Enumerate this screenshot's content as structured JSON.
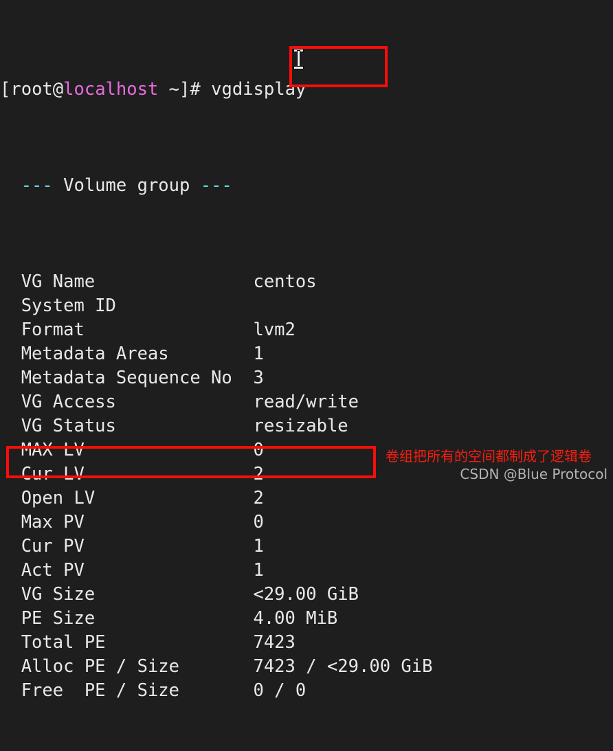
{
  "terminal": {
    "background_color": "#1e1e1e",
    "foreground_color": "#e8e8e8",
    "prompt": {
      "open_bracket": "[",
      "user": "root",
      "at": "@",
      "host": "localhost",
      "host_color": "#e66bdc",
      "path": " ~",
      "close_bracket": "]",
      "sigil": "# ",
      "command": "vgdisplay",
      "full_line": "[root@localhost ~]# vgdisplay"
    },
    "header": {
      "left_dashes": "  --- ",
      "title": "Volume group",
      "right_dashes": " ---",
      "dash_color": "#63d9ef"
    },
    "fields": [
      {
        "label": "  VG Name",
        "value": "centos"
      },
      {
        "label": "  System ID",
        "value": ""
      },
      {
        "label": "  Format",
        "value": "lvm2"
      },
      {
        "label": "  Metadata Areas",
        "value": "1"
      },
      {
        "label": "  Metadata Sequence No",
        "value": "3"
      },
      {
        "label": "  VG Access",
        "value": "read/write"
      },
      {
        "label": "  VG Status",
        "value": "resizable"
      },
      {
        "label": "  MAX LV",
        "value": "0"
      },
      {
        "label": "  Cur LV",
        "value": "2"
      },
      {
        "label": "  Open LV",
        "value": "2"
      },
      {
        "label": "  Max PV",
        "value": "0"
      },
      {
        "label": "  Cur PV",
        "value": "1"
      },
      {
        "label": "  Act PV",
        "value": "1"
      },
      {
        "label": "  VG Size",
        "value": "<29.00 GiB"
      },
      {
        "label": "  PE Size",
        "value": "4.00 MiB"
      },
      {
        "label": "  Total PE",
        "value": "7423"
      },
      {
        "label": "  Alloc PE / Size",
        "value": "7423 / <29.00 GiB"
      },
      {
        "label": "  Free  PE / Size",
        "value": "0 / 0"
      }
    ]
  },
  "annotations": {
    "highlight_color": "#fb0d09",
    "note_text": "卷组把所有的空间都制成了逻辑卷",
    "note_color": "#f71c10",
    "boxes": [
      {
        "name": "vg-name-value",
        "target": "centos"
      },
      {
        "name": "free-pe-size-row",
        "target": "Free  PE / Size  0 / 0"
      }
    ]
  },
  "watermark": {
    "text": "CSDN @Blue Protocol",
    "color": "#b4b4b4"
  }
}
